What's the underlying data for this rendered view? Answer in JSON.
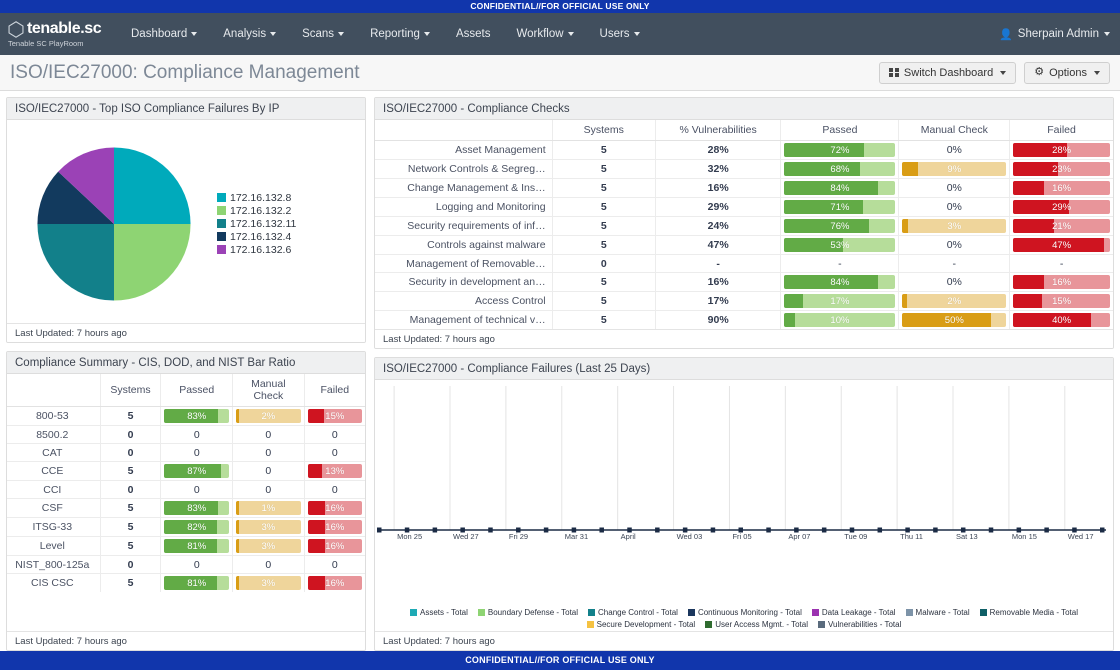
{
  "classification": {
    "top": "CONFIDENTIAL//FOR OFFICIAL USE ONLY",
    "bottom": "CONFIDENTIAL//FOR OFFICIAL USE ONLY",
    "color": "#1136ac"
  },
  "brand": {
    "name": "tenable.sc",
    "trademark": "®",
    "subtitle": "Tenable SC PlayRoom"
  },
  "nav": {
    "items": [
      {
        "label": "Dashboard",
        "caret": true
      },
      {
        "label": "Analysis",
        "caret": true
      },
      {
        "label": "Scans",
        "caret": true
      },
      {
        "label": "Reporting",
        "caret": true
      },
      {
        "label": "Assets",
        "caret": false
      },
      {
        "label": "Workflow",
        "caret": true
      },
      {
        "label": "Users",
        "caret": true
      }
    ],
    "user": "Sherpain Admin"
  },
  "page": {
    "title": "ISO/IEC27000: Compliance Management",
    "switch_dashboard": "Switch Dashboard",
    "options": "Options"
  },
  "pie_panel": {
    "title": "ISO/IEC27000 - Top ISO Compliance Failures By IP",
    "footer": "Last Updated: 7 hours ago"
  },
  "checks_panel": {
    "title": "ISO/IEC27000 - Compliance Checks",
    "footer": "Last Updated: 7 hours ago",
    "columns": [
      "",
      "Systems",
      "% Vulnerabilities",
      "Passed",
      "Manual Check",
      "Failed"
    ],
    "rows": [
      {
        "name": "Asset Management",
        "systems": "5",
        "vuln": "28%",
        "passed": "72%",
        "passed_v": 72,
        "manual": "0%",
        "manual_v": 0,
        "manual_bar": false,
        "failed": "28%",
        "failed_v": 28
      },
      {
        "name": "Network Controls & Segreg…",
        "systems": "5",
        "vuln": "32%",
        "passed": "68%",
        "passed_v": 68,
        "manual": "9%",
        "manual_v": 9,
        "manual_bar": true,
        "failed": "23%",
        "failed_v": 23
      },
      {
        "name": "Change Management & Ins…",
        "systems": "5",
        "vuln": "16%",
        "passed": "84%",
        "passed_v": 84,
        "manual": "0%",
        "manual_v": 0,
        "manual_bar": false,
        "failed": "16%",
        "failed_v": 16
      },
      {
        "name": "Logging and Monitoring",
        "systems": "5",
        "vuln": "29%",
        "passed": "71%",
        "passed_v": 71,
        "manual": "0%",
        "manual_v": 0,
        "manual_bar": false,
        "failed": "29%",
        "failed_v": 29
      },
      {
        "name": "Security requirements of inf…",
        "systems": "5",
        "vuln": "24%",
        "passed": "76%",
        "passed_v": 76,
        "manual": "3%",
        "manual_v": 3,
        "manual_bar": true,
        "failed": "21%",
        "failed_v": 21
      },
      {
        "name": "Controls against malware",
        "systems": "5",
        "vuln": "47%",
        "passed": "53%",
        "passed_v": 53,
        "manual": "0%",
        "manual_v": 0,
        "manual_bar": false,
        "failed": "47%",
        "failed_v": 47
      },
      {
        "name": "Management of Removable…",
        "systems": "0",
        "vuln": "-",
        "passed": "-",
        "passed_v": null,
        "manual": "-",
        "manual_v": null,
        "manual_bar": false,
        "failed": "-",
        "failed_v": null
      },
      {
        "name": "Security in development an…",
        "systems": "5",
        "vuln": "16%",
        "passed": "84%",
        "passed_v": 84,
        "manual": "0%",
        "manual_v": 0,
        "manual_bar": false,
        "failed": "16%",
        "failed_v": 16
      },
      {
        "name": "Access Control",
        "systems": "5",
        "vuln": "17%",
        "passed": "17%",
        "passed_v": 17,
        "manual": "2%",
        "manual_v": 2,
        "manual_bar": true,
        "failed": "15%",
        "failed_v": 15
      },
      {
        "name": "Management of technical v…",
        "systems": "5",
        "vuln": "90%",
        "passed": "10%",
        "passed_v": 10,
        "manual": "50%",
        "manual_v": 50,
        "manual_bar": true,
        "failed": "40%",
        "failed_v": 40
      }
    ]
  },
  "summary_panel": {
    "title": "Compliance Summary - CIS, DOD, and NIST Bar Ratio",
    "footer": "Last Updated: 7 hours ago",
    "columns": [
      "",
      "Systems",
      "Passed",
      "Manual Check",
      "Failed"
    ],
    "rows": [
      {
        "name": "800-53",
        "systems": "5",
        "passed": "83%",
        "passed_v": 83,
        "passed_bar": true,
        "manual": "2%",
        "manual_v": 2,
        "manual_bar": true,
        "failed": "15%",
        "failed_v": 15,
        "failed_bar": true
      },
      {
        "name": "8500.2",
        "systems": "0",
        "passed": "0",
        "passed_v": null,
        "passed_bar": false,
        "manual": "0",
        "manual_v": null,
        "manual_bar": false,
        "failed": "0",
        "failed_v": null,
        "failed_bar": false
      },
      {
        "name": "CAT",
        "systems": "0",
        "passed": "0",
        "passed_v": null,
        "passed_bar": false,
        "manual": "0",
        "manual_v": null,
        "manual_bar": false,
        "failed": "0",
        "failed_v": null,
        "failed_bar": false
      },
      {
        "name": "CCE",
        "systems": "5",
        "passed": "87%",
        "passed_v": 87,
        "passed_bar": true,
        "manual": "0",
        "manual_v": null,
        "manual_bar": false,
        "failed": "13%",
        "failed_v": 13,
        "failed_bar": true
      },
      {
        "name": "CCI",
        "systems": "0",
        "passed": "0",
        "passed_v": null,
        "passed_bar": false,
        "manual": "0",
        "manual_v": null,
        "manual_bar": false,
        "failed": "0",
        "failed_v": null,
        "failed_bar": false
      },
      {
        "name": "CSF",
        "systems": "5",
        "passed": "83%",
        "passed_v": 83,
        "passed_bar": true,
        "manual": "1%",
        "manual_v": 1,
        "manual_bar": true,
        "failed": "16%",
        "failed_v": 16,
        "failed_bar": true
      },
      {
        "name": "ITSG-33",
        "systems": "5",
        "passed": "82%",
        "passed_v": 82,
        "passed_bar": true,
        "manual": "3%",
        "manual_v": 3,
        "manual_bar": true,
        "failed": "16%",
        "failed_v": 16,
        "failed_bar": true
      },
      {
        "name": "Level",
        "systems": "5",
        "passed": "81%",
        "passed_v": 81,
        "passed_bar": true,
        "manual": "3%",
        "manual_v": 3,
        "manual_bar": true,
        "failed": "16%",
        "failed_v": 16,
        "failed_bar": true
      },
      {
        "name": "NIST_800-125a",
        "systems": "0",
        "passed": "0",
        "passed_v": null,
        "passed_bar": false,
        "manual": "0",
        "manual_v": null,
        "manual_bar": false,
        "failed": "0",
        "failed_v": null,
        "failed_bar": false
      },
      {
        "name": "CIS CSC",
        "systems": "5",
        "passed": "81%",
        "passed_v": 81,
        "passed_bar": true,
        "manual": "3%",
        "manual_v": 3,
        "manual_bar": true,
        "failed": "16%",
        "failed_v": 16,
        "failed_bar": true
      }
    ]
  },
  "trend_panel": {
    "title": "ISO/IEC27000 - Compliance Failures (Last 25 Days)",
    "footer": "Last Updated: 7 hours ago"
  },
  "chart_data": [
    {
      "type": "pie",
      "title": "ISO/IEC27000 - Top ISO Compliance Failures By IP",
      "legend_position": "right",
      "labels": [
        "172.16.132.8",
        "172.16.132.2",
        "172.16.132.11",
        "172.16.132.4",
        "172.16.132.6"
      ],
      "values": [
        25,
        25,
        25,
        12,
        13
      ],
      "colors": [
        "#00aabb",
        "#8ed473",
        "#12808a",
        "#123a5e",
        "#9b42b6"
      ]
    },
    {
      "type": "line",
      "title": "ISO/IEC27000 - Compliance Failures (Last 25 Days)",
      "xlabel": "",
      "ylabel": "",
      "grid": true,
      "legend_position": "bottom",
      "x_ticks": [
        "Mon 25",
        "Wed 27",
        "Fri 29",
        "Mar 31",
        "April",
        "Wed 03",
        "Fri 05",
        "Apr 07",
        "Tue 09",
        "Thu 11",
        "Sat 13",
        "Mon 15",
        "Wed 17"
      ],
      "series": [
        {
          "name": "Assets - Total",
          "color": "#1eaab5",
          "values": []
        },
        {
          "name": "Boundary Defense - Total",
          "color": "#8ed473",
          "values": []
        },
        {
          "name": "Change Control - Total",
          "color": "#12808a",
          "values": []
        },
        {
          "name": "Continuous Monitoring - Total",
          "color": "#1b365d",
          "values": []
        },
        {
          "name": "Data Leakage - Total",
          "color": "#9b32b0",
          "values": []
        },
        {
          "name": "Malware - Total",
          "color": "#7d93a8",
          "values": []
        },
        {
          "name": "Removable Media - Total",
          "color": "#0e5f66",
          "values": []
        },
        {
          "name": "Secure Development - Total",
          "color": "#f5c242",
          "values": []
        },
        {
          "name": "User Access Mgmt. - Total",
          "color": "#2f6b2f",
          "values": []
        },
        {
          "name": "Vulnerabilities - Total",
          "color": "#5a6b7d",
          "values": []
        }
      ]
    }
  ]
}
